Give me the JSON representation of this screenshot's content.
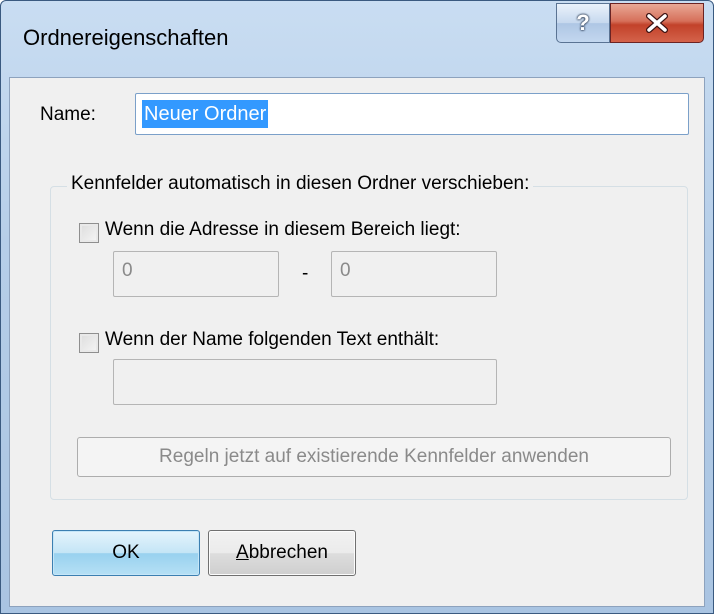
{
  "window": {
    "title": "Ordnereigenschaften",
    "help_label": "?",
    "close_icon": "close-icon"
  },
  "name_field": {
    "label": "Name:",
    "value": "Neuer Ordner"
  },
  "group": {
    "legend": "Kennfelder automatisch in diesen Ordner verschieben:",
    "address_rule": {
      "checkbox_label": "Wenn die Adresse in diesem Bereich liegt:",
      "checked": false,
      "from_value": "0",
      "separator": "-",
      "to_value": "0"
    },
    "name_rule": {
      "checkbox_label": "Wenn der Name folgenden Text enthält:",
      "checked": false,
      "text_value": ""
    },
    "apply_button": "Regeln jetzt auf existierende Kennfelder anwenden"
  },
  "buttons": {
    "ok": "OK",
    "cancel_mnemonic": "A",
    "cancel_rest": "bbrechen"
  },
  "colors": {
    "titlebar": "#b6cee8",
    "close_button": "#c2422a",
    "selection": "#3399ff",
    "dialog_bg": "#f0f0f0"
  }
}
